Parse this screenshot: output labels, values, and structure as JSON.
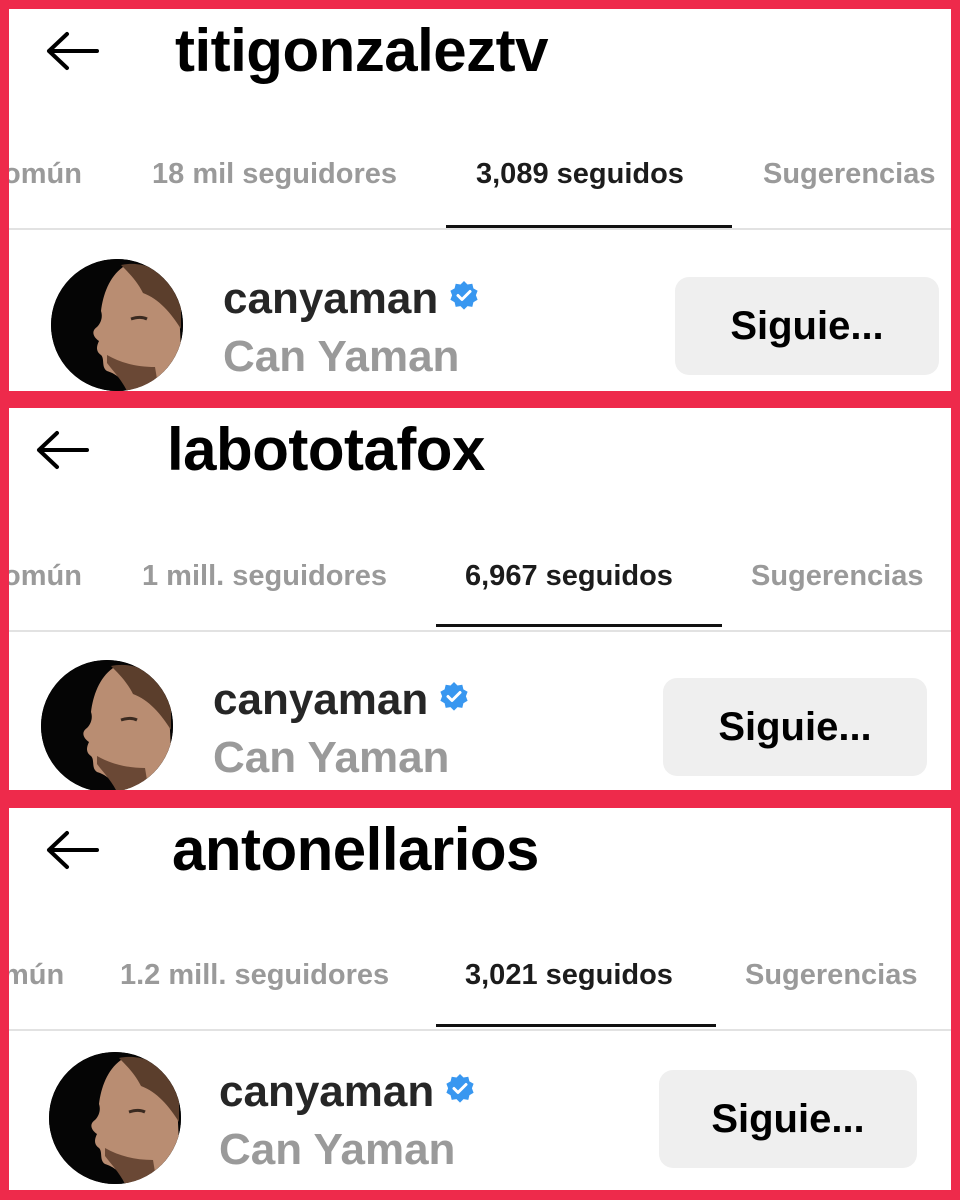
{
  "panels": [
    {
      "username": "titigonzaleztv",
      "tabs": [
        "omún",
        "18 mil seguidores",
        "3,089 seguidos",
        "Sugerencias"
      ],
      "active_tab": 2,
      "user": {
        "handle": "canyaman",
        "verified": true,
        "full_name": "Can Yaman",
        "button_label": "Siguie..."
      }
    },
    {
      "username": "labototafox",
      "tabs": [
        "omún",
        "1 mill. seguidores",
        "6,967 seguidos",
        "Sugerencias"
      ],
      "active_tab": 2,
      "user": {
        "handle": "canyaman",
        "verified": true,
        "full_name": "Can Yaman",
        "button_label": "Siguie..."
      }
    },
    {
      "username": "antonellarios",
      "tabs": [
        "mún",
        "1.2 mill. seguidores",
        "3,021 seguidos",
        "Sugerencias"
      ],
      "active_tab": 2,
      "user": {
        "handle": "canyaman",
        "verified": true,
        "full_name": "Can Yaman",
        "button_label": "Siguie..."
      }
    }
  ],
  "icons": {
    "back": "arrow-left-icon",
    "verified": "verified-badge-icon",
    "avatar": "profile-photo"
  },
  "colors": {
    "border": "#ee2a4b",
    "verified": "#3897f0",
    "button_bg": "#efefef",
    "muted_text": "#9a9a9a"
  }
}
